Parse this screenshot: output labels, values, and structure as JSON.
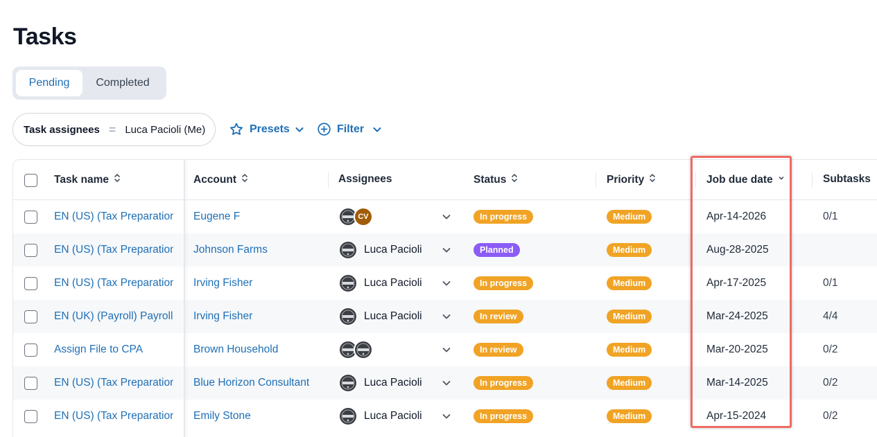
{
  "page": {
    "title": "Tasks"
  },
  "tabs": {
    "pending": "Pending",
    "completed": "Completed"
  },
  "filter_chip": {
    "key": "Task assignees",
    "operator": "=",
    "value": "Luca Pacioli (Me)"
  },
  "toolbar": {
    "presets": "Presets",
    "filter": "Filter"
  },
  "table": {
    "headers": {
      "task_name": "Task name",
      "account": "Account",
      "assignees": "Assignees",
      "status": "Status",
      "priority": "Priority",
      "job_due_date": "Job due date",
      "subtasks": "Subtasks"
    },
    "rows": [
      {
        "task": "EN (US) (Tax Preparation)",
        "account": "Eugene F",
        "assignee_name": "",
        "avatars": [
          "ledger",
          "CV"
        ],
        "status": "In progress",
        "priority": "Medium",
        "due": "Apr-14-2026",
        "subtasks": "0/1"
      },
      {
        "task": "EN (US) (Tax Preparation)",
        "account": "Johnson Farms",
        "assignee_name": "Luca Pacioli",
        "avatars": [
          "ledger"
        ],
        "status": "Planned",
        "priority": "Medium",
        "due": "Aug-28-2025",
        "subtasks": ""
      },
      {
        "task": "EN (US) (Tax Preparation)",
        "account": "Irving Fisher",
        "assignee_name": "Luca Pacioli",
        "avatars": [
          "ledger"
        ],
        "status": "In progress",
        "priority": "Medium",
        "due": "Apr-17-2025",
        "subtasks": "0/1"
      },
      {
        "task": "EN (UK) (Payroll) Payroll -",
        "account": "Irving Fisher",
        "assignee_name": "Luca Pacioli",
        "avatars": [
          "ledger"
        ],
        "status": "In review",
        "priority": "Medium",
        "due": "Mar-24-2025",
        "subtasks": "4/4"
      },
      {
        "task": "Assign File to CPA",
        "account": "Brown Household",
        "assignee_name": "",
        "avatars": [
          "ledger",
          "ledger"
        ],
        "status": "In review",
        "priority": "Medium",
        "due": "Mar-20-2025",
        "subtasks": "0/2"
      },
      {
        "task": "EN (US) (Tax Preparation)",
        "account": "Blue Horizon Consultant",
        "assignee_name": "Luca Pacioli",
        "avatars": [
          "ledger"
        ],
        "status": "In progress",
        "priority": "Medium",
        "due": "Mar-14-2025",
        "subtasks": "0/2"
      },
      {
        "task": "EN (US) (Tax Preparation)",
        "account": "Emily Stone",
        "assignee_name": "Luca Pacioli",
        "avatars": [
          "ledger"
        ],
        "status": "In progress",
        "priority": "Medium",
        "due": "Apr-15-2024",
        "subtasks": "0/2"
      }
    ]
  },
  "colors": {
    "link": "#1f6fb5",
    "in_progress": "#f0a324",
    "in_review": "#f0a324",
    "planned": "#8b5cf6",
    "medium": "#f0a324",
    "highlight": "#ee6b63"
  },
  "icons": {
    "presets": "star-icon",
    "filter": "plus-circle-icon",
    "dropdown": "chevron-down-icon",
    "sort": "sort-updown-icon"
  }
}
